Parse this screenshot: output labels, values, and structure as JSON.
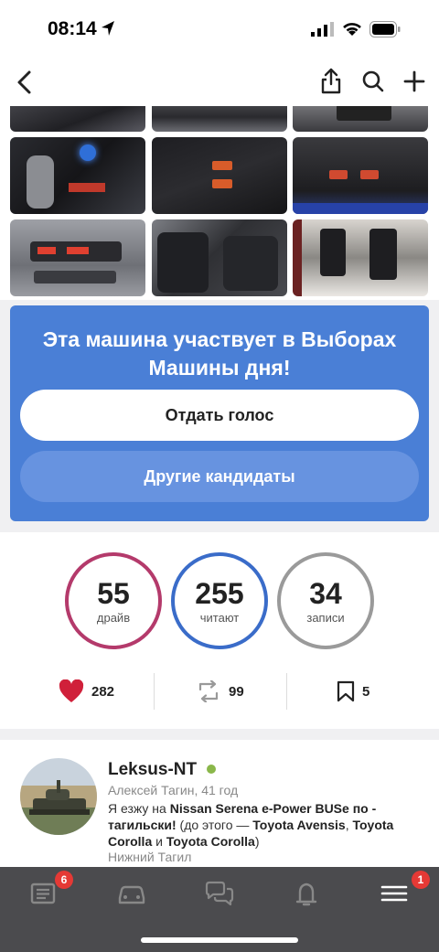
{
  "status": {
    "time": "08:14"
  },
  "vote": {
    "title": "Эта машина участвует в Выборах Машины дня!",
    "vote_button": "Отдать голос",
    "candidates_button": "Другие кандидаты"
  },
  "stats": {
    "drives": {
      "value": "55",
      "label": "драйв"
    },
    "readers": {
      "value": "255",
      "label": "читают"
    },
    "posts": {
      "value": "34",
      "label": "записи"
    },
    "colors": {
      "drives": "#b43a6b",
      "readers": "#3a6cc9",
      "posts": "#9a9a9a"
    }
  },
  "reactions": {
    "likes": "282",
    "reposts": "99",
    "bookmarks": "5"
  },
  "profile": {
    "name": "Leksus-NT",
    "subtitle": "Алексей Тагин, 41 год",
    "desc_prefix": "Я езжу на ",
    "car": "Nissan Serena e-Power BUSe по - тагильски!",
    "desc_middle": " (до этого — ",
    "prev_car_1": "Toyota Avensis",
    "desc_sep": ", ",
    "prev_car_2": "Toyota Corolla",
    "desc_and": " и ",
    "prev_car_3": "Toyota Corolla",
    "desc_suffix": ")",
    "city": "Нижний Тагил"
  },
  "tabs": {
    "feed_badge": "6",
    "menu_badge": "1",
    "icons": [
      "feed-icon",
      "garage-car-icon",
      "chat-icon",
      "notifications-bell-icon",
      "menu-icon"
    ]
  }
}
